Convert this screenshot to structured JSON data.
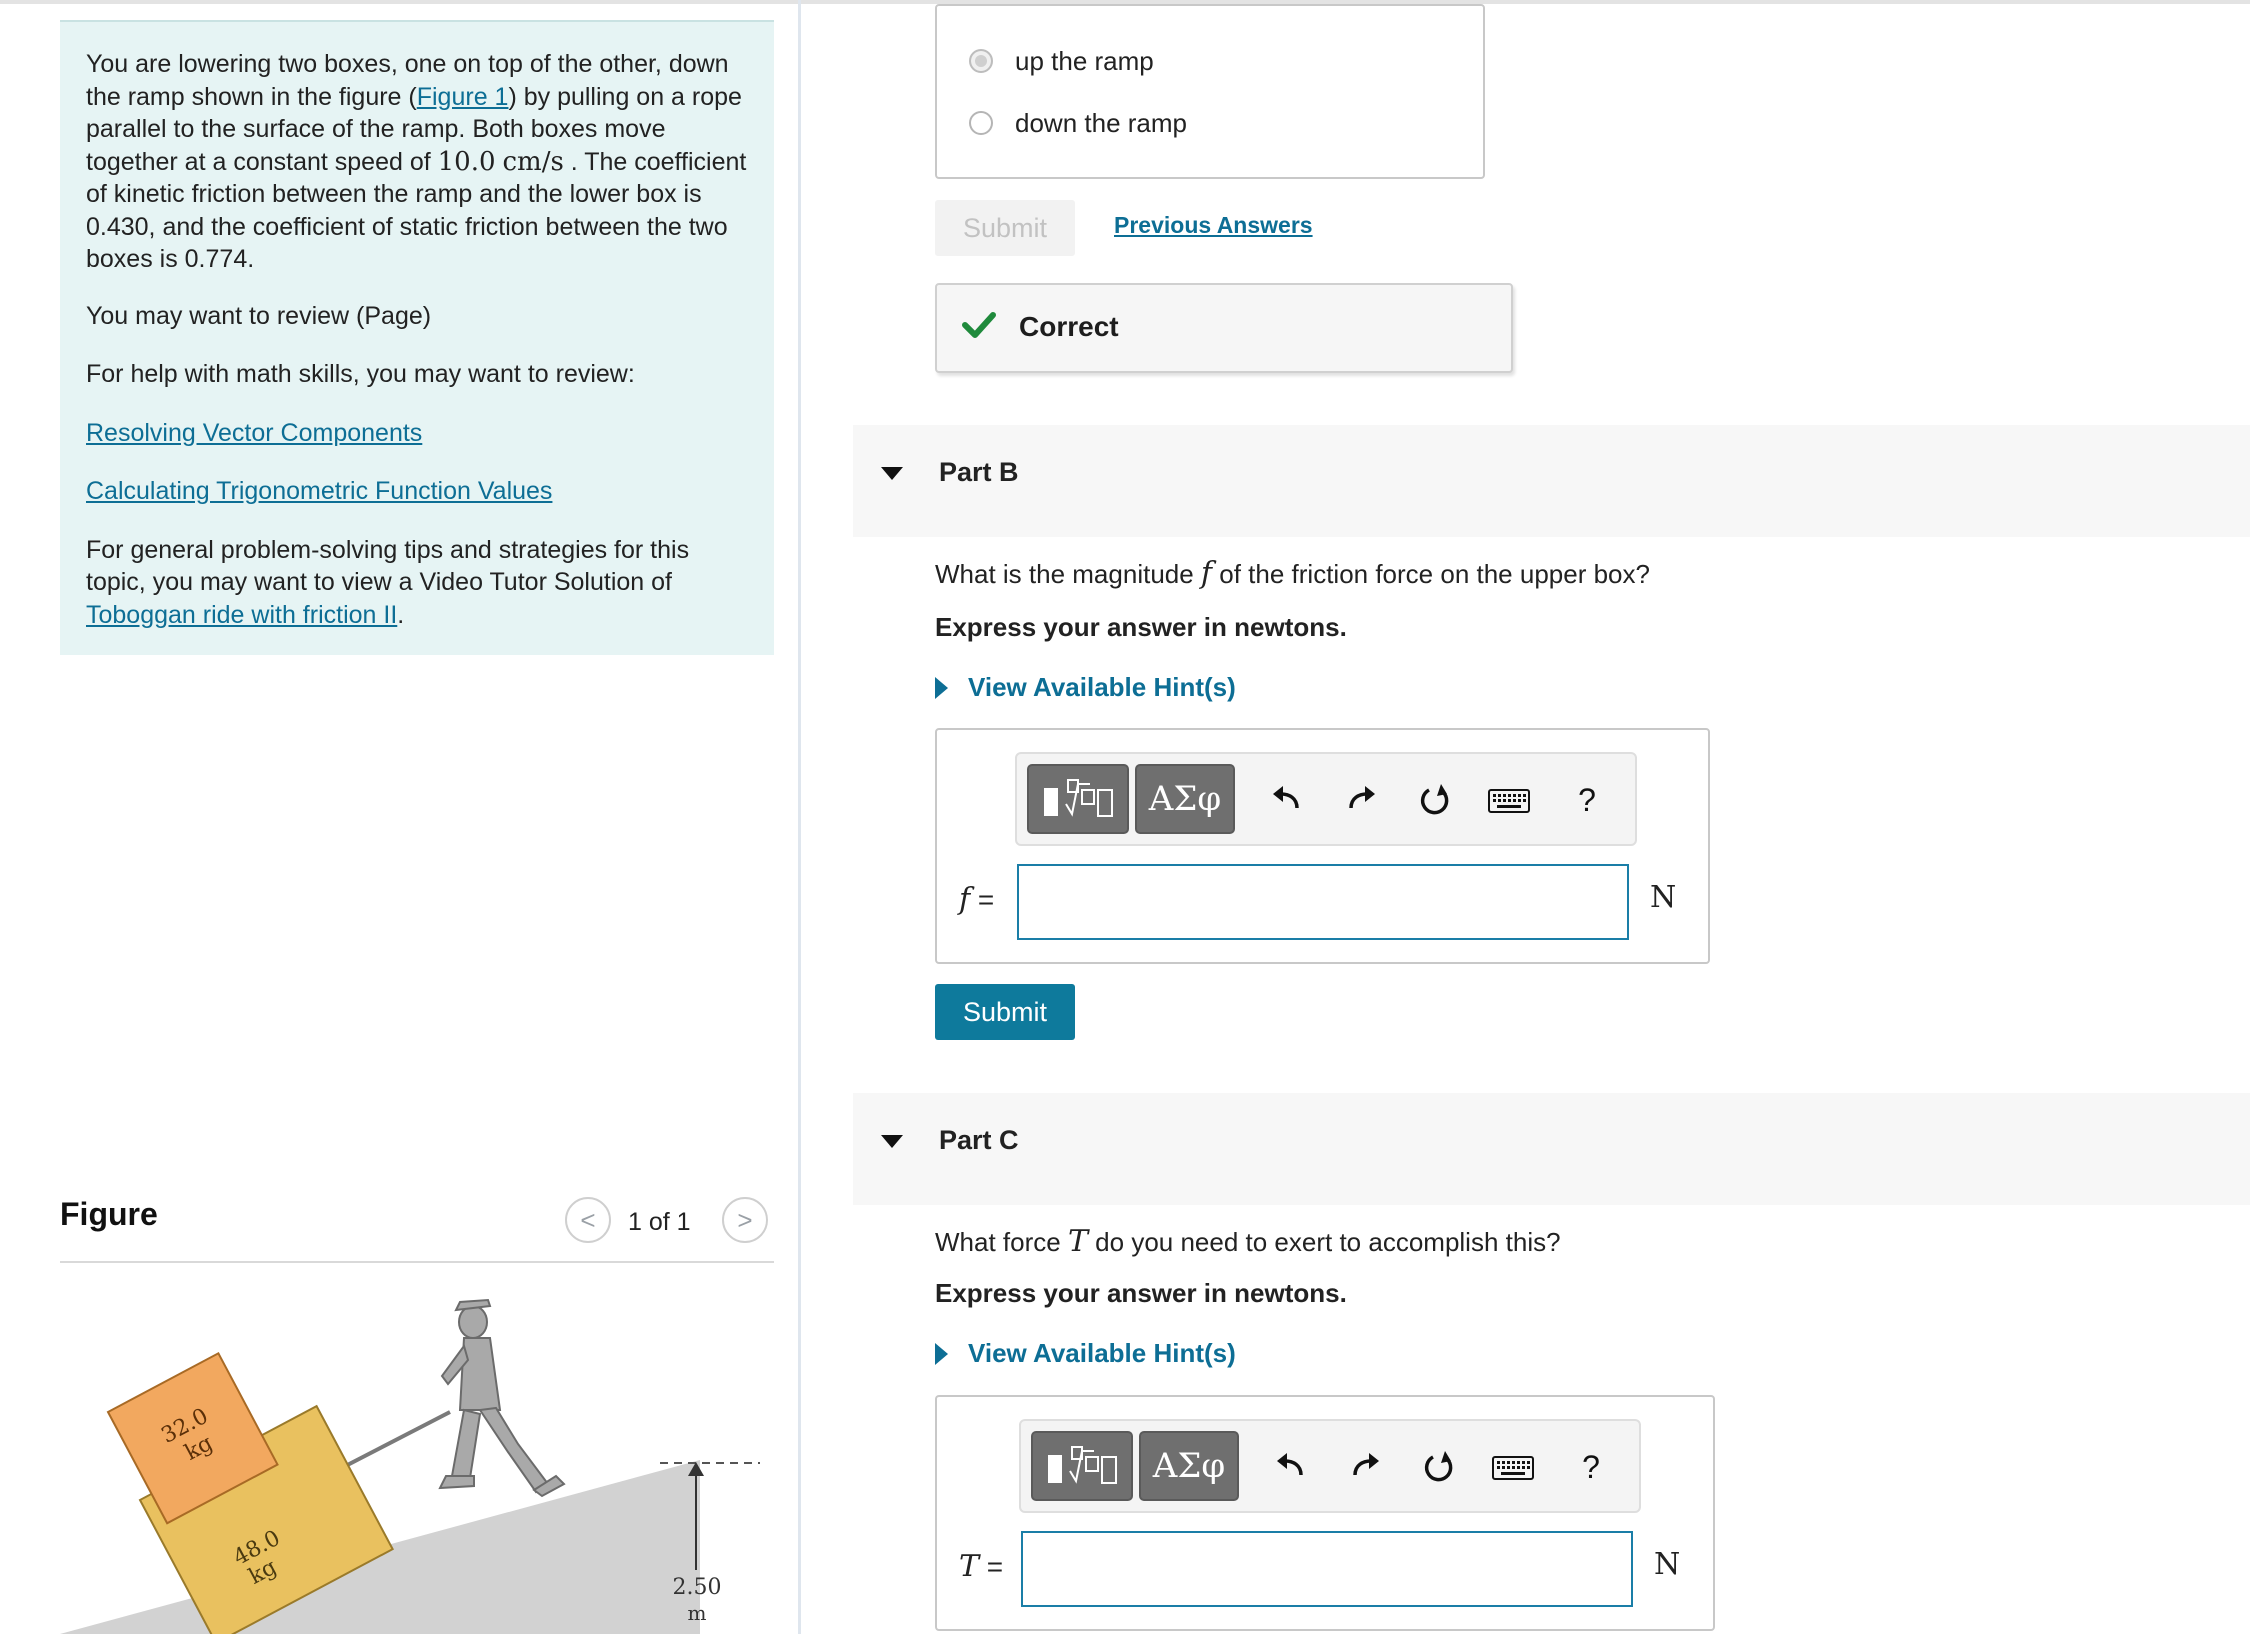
{
  "intro": {
    "p1_a": "You are lowering two boxes, one on top of the other, down the ramp shown in the figure (",
    "p1_link": "Figure 1",
    "p1_b": ") by pulling on a rope parallel to the surface of the ramp. Both boxes move together at a constant speed of ",
    "p1_speed": "10.0",
    "p1_unit": "cm/s",
    "p1_c": " . The coefficient of kinetic friction between the ramp and the lower box is 0.430, and the coefficient of static friction between the two boxes is 0.774.",
    "review": "You may want to review (Page)",
    "math_help": "For help with math skills, you may want to review:",
    "link1": "Resolving Vector Components",
    "link2": "Calculating Trigonometric Function Values",
    "tips_a": "For general problem-solving tips and strategies for this topic, you may want to view a Video Tutor Solution of ",
    "tips_link": "Toboggan ride with friction II",
    "tips_b": "."
  },
  "figure": {
    "title": "Figure",
    "pager": "1 of 1",
    "prev": "<",
    "next": ">",
    "top_box_mass": "32.0",
    "top_box_unit": "kg",
    "bottom_box_mass": "48.0",
    "bottom_box_unit": "kg",
    "height_value": "2.50",
    "height_unit": "m"
  },
  "partA": {
    "options": [
      "up the ramp",
      "down the ramp"
    ],
    "selected_index": 0,
    "submit_label": "Submit",
    "prev_answers": "Previous Answers",
    "feedback": "Correct"
  },
  "partB": {
    "title": "Part B",
    "question_a": "What is the magnitude ",
    "question_var": "f",
    "question_b": " of the friction force on the upper box?",
    "express": "Express your answer in newtons.",
    "hint": "View Available Hint(s)",
    "var_label": "f",
    "eq": " =",
    "unit": "N",
    "submit_label": "Submit",
    "greek_label": "ΑΣφ",
    "help_label": "?"
  },
  "partC": {
    "title": "Part C",
    "question_a": "What force ",
    "question_var": "T",
    "question_b": " do you need to exert to accomplish this?",
    "express": "Express your answer in newtons.",
    "hint": "View Available Hint(s)",
    "var_label": "T",
    "eq": " =",
    "unit": "N",
    "greek_label": "ΑΣφ",
    "help_label": "?"
  },
  "colors": {
    "accent": "#0e7a9c",
    "link": "#0d6e95",
    "correct_green": "#1f8a3c",
    "intro_bg": "#e6f4f4",
    "top_box": "#f2a85f",
    "bottom_box": "#e9c15f",
    "ramp": "#d2d2d2"
  },
  "icons": [
    "undo-icon",
    "redo-icon",
    "reset-icon",
    "keyboard-icon",
    "templates-icon",
    "check-icon",
    "caret-down-icon",
    "caret-right-icon"
  ]
}
